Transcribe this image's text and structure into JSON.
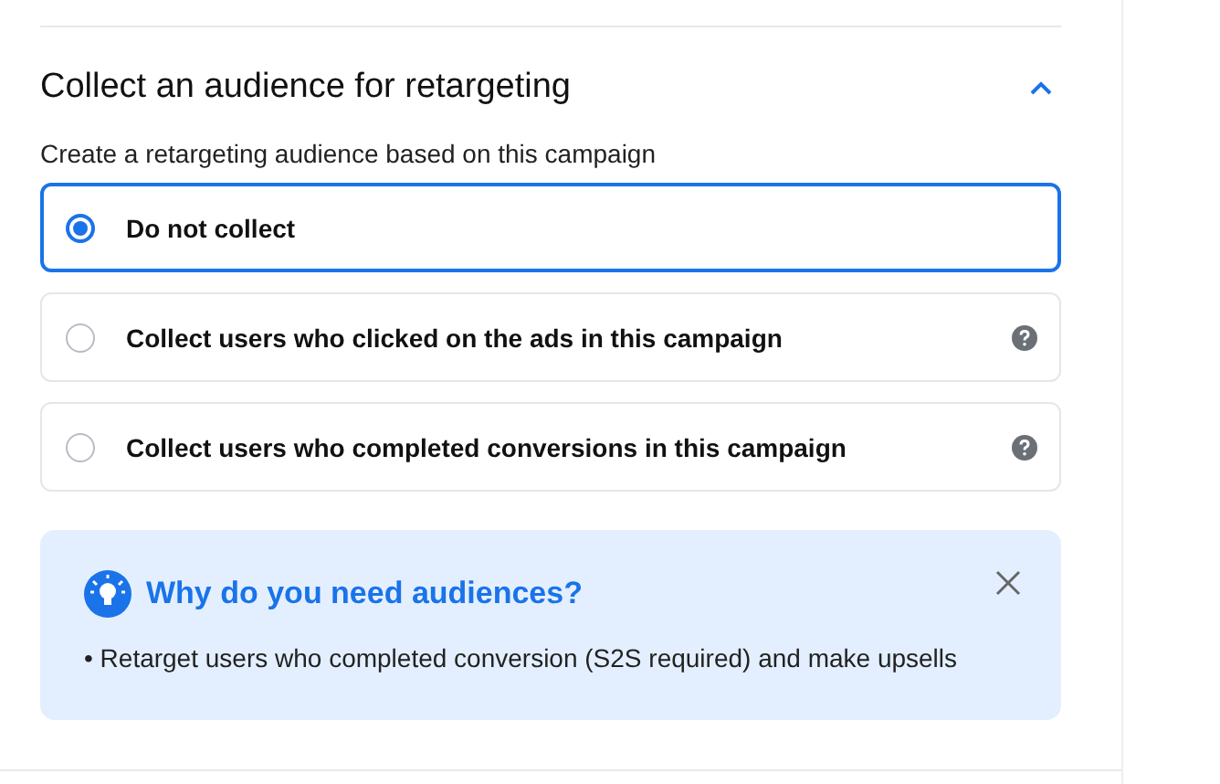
{
  "section": {
    "title": "Collect an audience for retargeting",
    "expanded": true,
    "subtitle": "Create a retargeting audience based on this campaign"
  },
  "options": [
    {
      "label": "Do not collect",
      "selected": true,
      "help": false
    },
    {
      "label": "Collect users who clicked on the ads in this campaign",
      "selected": false,
      "help": true
    },
    {
      "label": "Collect users who completed conversions in this campaign",
      "selected": false,
      "help": true
    }
  ],
  "info": {
    "title": "Why do you need audiences?",
    "bullets": [
      "• Retarget users who completed conversion (S2S required) and make upsells"
    ]
  }
}
